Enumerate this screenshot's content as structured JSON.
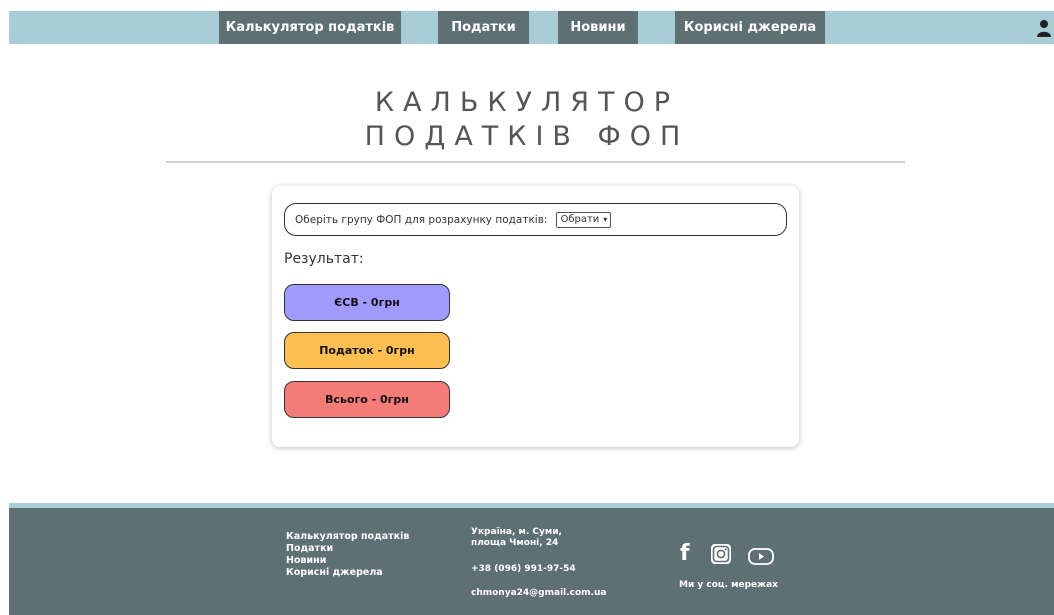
{
  "nav": {
    "items": [
      "Калькулятор податків",
      "Податки",
      "Новини",
      "Корисні джерела"
    ],
    "user_icon": "user-icon"
  },
  "title": {
    "line1": "КАЛЬКУЛЯТОР",
    "line2": "ПОДАТКІВ ФОП"
  },
  "calculator": {
    "select_label": "Оберіть групу ФОП для розрахунку податків:",
    "select_value": "Обрати",
    "result_label": "Результат:",
    "esv": "ЄСВ - 0грн",
    "tax": "Податок - 0грн",
    "total": "Всього - 0грн",
    "colors": {
      "esv": "#a29bfe",
      "tax": "#fdbf4f",
      "total": "#f37b78"
    }
  },
  "footer": {
    "links": [
      "Калькулятор податків",
      "Податки",
      "Новини",
      "Корисні джерела"
    ],
    "address_line1": "Україна, м. Суми,",
    "address_line2": "площа Чмоні, 24",
    "phone": "+38 (096) 991-97-54",
    "email": "chmonya24@gmail.com.ua",
    "social_icons": [
      "facebook-icon",
      "instagram-icon",
      "youtube-icon"
    ],
    "social_label": "Ми у соц. мережах"
  }
}
